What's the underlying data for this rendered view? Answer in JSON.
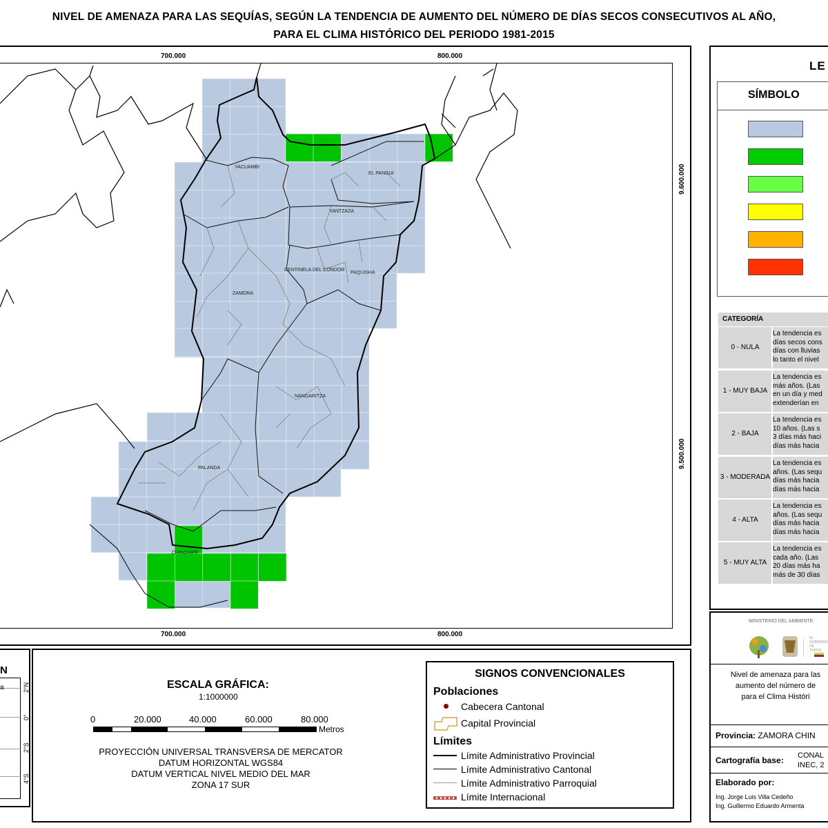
{
  "title": {
    "line1": "NIVEL DE AMENAZA PARA LAS SEQUÍAS, SEGÚN LA TENDENCIA DE AUMENTO DEL NÚMERO DE DÍAS SECOS CONSECUTIVOS AL AÑO,",
    "line2": "PARA EL CLIMA HISTÓRICO DEL PERIODO 1981-2015"
  },
  "map": {
    "x_ticks": [
      "700.000",
      "800.000"
    ],
    "y_ticks": [
      "9.600.000",
      "9.500.000"
    ],
    "towns": [
      "YACUAMBI",
      "EL PANGUI",
      "YANTZAZA",
      "CENTINELA DEL CONDOR",
      "PAQUISHA",
      "ZAMORA",
      "NANGARITZA",
      "PALANDA",
      "CHINCHIPE"
    ],
    "colors": {
      "grid_cell": "#b9c9df",
      "green_cell": "#00c400",
      "grid_line": "#e8eef6"
    }
  },
  "legend": {
    "title": "LE",
    "symbol_header": "SÍMBOLO",
    "swatch_colors": [
      "#b9c9df",
      "#00cc00",
      "#66ff44",
      "#ffff00",
      "#ffb300",
      "#ff3300"
    ],
    "category_header": "CATEGORÍA",
    "categories": [
      {
        "name": "0 - NULA",
        "lines": [
          "La tendencia es",
          "días secos cons",
          "días con lluvias",
          "lo tanto el nivel"
        ]
      },
      {
        "name": "1 - MUY BAJA",
        "lines": [
          "La tendencia es",
          "más años. (Las",
          "en un día y med",
          "extenderían en"
        ]
      },
      {
        "name": "2 - BAJA",
        "lines": [
          "La tendencia es",
          "10 años. (Las s",
          "3 días más haci",
          "días más hacia"
        ]
      },
      {
        "name": "3 - MODERADA",
        "lines": [
          "La tendencia es",
          "años. (Las sequ",
          "días más hacia",
          "días más hacia"
        ]
      },
      {
        "name": "4 - ALTA",
        "lines": [
          "La tendencia es",
          "años. (Las sequ",
          "días más hacia",
          "días más hacia"
        ]
      },
      {
        "name": "5 - MUY ALTA",
        "lines": [
          "La tendencia es",
          "cada año. (Las",
          "20 días más ha",
          "más de 30 días"
        ]
      }
    ]
  },
  "locator": {
    "title": "N",
    "lat_labels": [
      "2°N",
      "0°",
      "2°S",
      "4°S"
    ],
    "partial_text": "a"
  },
  "scale": {
    "title": "ESCALA GRÁFICA:",
    "ratio": "1:1000000",
    "labels": [
      "0",
      "20.000",
      "40.000",
      "60.000",
      "80.000"
    ],
    "unit": "Metros",
    "projection": [
      "PROYECCIÓN UNIVERSAL TRANSVERSA DE MERCATOR",
      "DATUM HORIZONTAL WGS84",
      "DATUM VERTICAL NIVEL MEDIO DEL MAR",
      "ZONA 17 SUR"
    ]
  },
  "signs": {
    "title": "SIGNOS CONVENCIONALES",
    "poblaciones": "Poblaciones",
    "cabecera": "Cabecera Cantonal",
    "capital": "Capital Provincial",
    "limites": "Límites",
    "lim_prov": "Límite Administrativo Provincial",
    "lim_cant": "Límite Administrativo Cantonal",
    "lim_parr": "Límite Administrativo Parroquial",
    "lim_int": "Límite Internacional",
    "cabecera_color": "#8b0000",
    "capital_color": "#d9a64a",
    "intl_color": "#c05050"
  },
  "info": {
    "ministry": "MINISTERIO DEL AMBIENTE",
    "gov_text": "EL GOBIERNO DE TODOS",
    "desc": [
      "Nivel de amenaza para las",
      "aumento del número de",
      "para el Clima Históri"
    ],
    "provincia_label": "Provincia:",
    "provincia_value": "ZAMORA CHIN",
    "carto_label": "Cartografía base:",
    "carto_value": [
      "CONAL",
      "INEC, 2"
    ],
    "elaborado_label": "Elaborado por:",
    "authors": [
      "Ing. Jorge Luis Villa Cedeño",
      "Ing. Guillermo Eduardo Armenta"
    ]
  }
}
